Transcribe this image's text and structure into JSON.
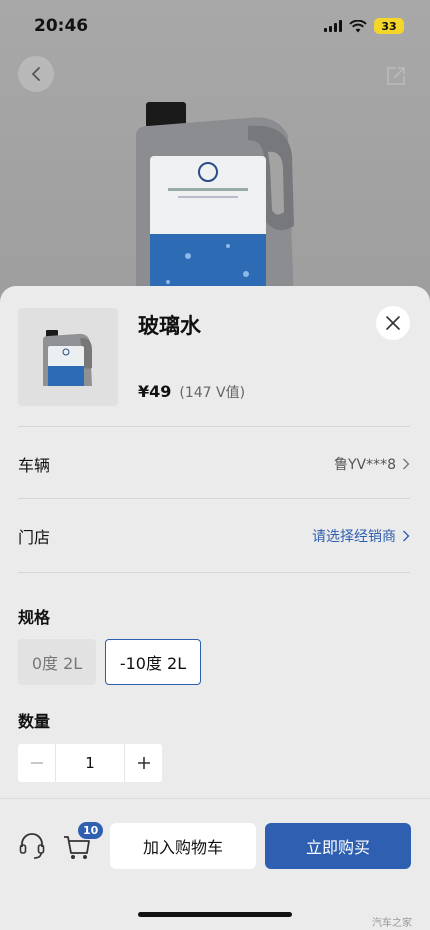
{
  "status_bar": {
    "time": "20:46",
    "battery": "33"
  },
  "product": {
    "name": "玻璃水",
    "price": "¥49",
    "vcoin": "(147 V值)"
  },
  "vehicle": {
    "label": "车辆",
    "value": "鲁YV***8"
  },
  "store": {
    "label": "门店",
    "value": "请选择经销商"
  },
  "spec": {
    "title": "规格",
    "options": [
      "0度 2L",
      "-10度 2L"
    ],
    "selected": "-10度 2L"
  },
  "quantity": {
    "title": "数量",
    "value": "1",
    "minus": "−",
    "plus": "+"
  },
  "footer": {
    "cart_count": "10",
    "add_to_cart": "加入购物车",
    "buy_now": "立即购买"
  },
  "watermark": "汽车之家",
  "colors": {
    "accent": "#2f5fb0",
    "sheet_bg": "#ebebeb",
    "battery": "#f4d62a"
  },
  "icons": [
    "back-icon",
    "share-icon",
    "close-icon",
    "chevron-right-icon",
    "headset-icon",
    "cart-icon"
  ]
}
